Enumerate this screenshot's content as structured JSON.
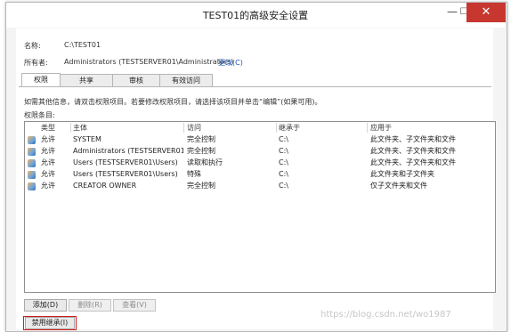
{
  "window": {
    "title": "TEST01的高级安全设置",
    "close_glyph": "✕",
    "min_glyph": "—",
    "max_glyph": "☐"
  },
  "fields": {
    "name_label": "名称:",
    "name_value": "C:\\TEST01",
    "owner_label": "所有者:",
    "owner_value": "Administrators (TESTSERVER01\\Administrators)",
    "owner_change_link": "更改(C)"
  },
  "tabs": [
    {
      "label": "权限",
      "active": true
    },
    {
      "label": "共享",
      "active": false
    },
    {
      "label": "审核",
      "active": false
    },
    {
      "label": "有效访问",
      "active": false
    }
  ],
  "info_text": "如需其他信息，请双击权限项目。若要修改权限项目，请选择该项目并单击“编辑”(如果可用)。",
  "entries_label": "权限条目:",
  "columns": [
    "类型",
    "主体",
    "访问",
    "继承于",
    "应用于"
  ],
  "rows": [
    {
      "type": "允许",
      "principal": "SYSTEM",
      "access": "完全控制",
      "inherited": "C:\\",
      "applies": "此文件夹、子文件夹和文件"
    },
    {
      "type": "允许",
      "principal": "Administrators (TESTSERVER01\\...",
      "access": "完全控制",
      "inherited": "C:\\",
      "applies": "此文件夹、子文件夹和文件"
    },
    {
      "type": "允许",
      "principal": "Users (TESTSERVER01\\Users)",
      "access": "读取和执行",
      "inherited": "C:\\",
      "applies": "此文件夹、子文件夹和文件"
    },
    {
      "type": "允许",
      "principal": "Users (TESTSERVER01\\Users)",
      "access": "特殊",
      "inherited": "C:\\",
      "applies": "此文件夹和子文件夹"
    },
    {
      "type": "允许",
      "principal": "CREATOR OWNER",
      "access": "完全控制",
      "inherited": "C:\\",
      "applies": "仅子文件夹和文件"
    }
  ],
  "buttons": {
    "add": "添加(D)",
    "remove": "删除(R)",
    "view": "查看(V)",
    "disable_inheritance": "禁用继承(I)"
  },
  "watermark": "https://blog.csdn.net/wo1987",
  "colors": {
    "close_button": "#c7372f",
    "link": "#1a57b8",
    "highlight_border": "#d21b1b"
  }
}
